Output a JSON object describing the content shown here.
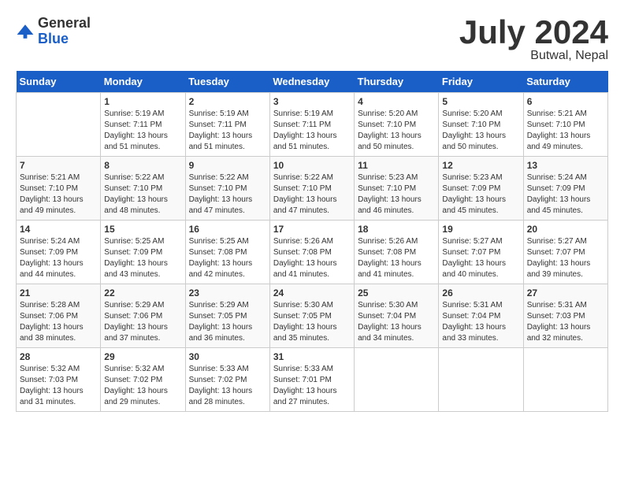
{
  "header": {
    "logo_general": "General",
    "logo_blue": "Blue",
    "month_title": "July 2024",
    "location": "Butwal, Nepal"
  },
  "weekdays": [
    "Sunday",
    "Monday",
    "Tuesday",
    "Wednesday",
    "Thursday",
    "Friday",
    "Saturday"
  ],
  "weeks": [
    [
      {
        "day": "",
        "info": ""
      },
      {
        "day": "1",
        "info": "Sunrise: 5:19 AM\nSunset: 7:11 PM\nDaylight: 13 hours\nand 51 minutes."
      },
      {
        "day": "2",
        "info": "Sunrise: 5:19 AM\nSunset: 7:11 PM\nDaylight: 13 hours\nand 51 minutes."
      },
      {
        "day": "3",
        "info": "Sunrise: 5:19 AM\nSunset: 7:11 PM\nDaylight: 13 hours\nand 51 minutes."
      },
      {
        "day": "4",
        "info": "Sunrise: 5:20 AM\nSunset: 7:10 PM\nDaylight: 13 hours\nand 50 minutes."
      },
      {
        "day": "5",
        "info": "Sunrise: 5:20 AM\nSunset: 7:10 PM\nDaylight: 13 hours\nand 50 minutes."
      },
      {
        "day": "6",
        "info": "Sunrise: 5:21 AM\nSunset: 7:10 PM\nDaylight: 13 hours\nand 49 minutes."
      }
    ],
    [
      {
        "day": "7",
        "info": "Sunrise: 5:21 AM\nSunset: 7:10 PM\nDaylight: 13 hours\nand 49 minutes."
      },
      {
        "day": "8",
        "info": "Sunrise: 5:22 AM\nSunset: 7:10 PM\nDaylight: 13 hours\nand 48 minutes."
      },
      {
        "day": "9",
        "info": "Sunrise: 5:22 AM\nSunset: 7:10 PM\nDaylight: 13 hours\nand 47 minutes."
      },
      {
        "day": "10",
        "info": "Sunrise: 5:22 AM\nSunset: 7:10 PM\nDaylight: 13 hours\nand 47 minutes."
      },
      {
        "day": "11",
        "info": "Sunrise: 5:23 AM\nSunset: 7:10 PM\nDaylight: 13 hours\nand 46 minutes."
      },
      {
        "day": "12",
        "info": "Sunrise: 5:23 AM\nSunset: 7:09 PM\nDaylight: 13 hours\nand 45 minutes."
      },
      {
        "day": "13",
        "info": "Sunrise: 5:24 AM\nSunset: 7:09 PM\nDaylight: 13 hours\nand 45 minutes."
      }
    ],
    [
      {
        "day": "14",
        "info": "Sunrise: 5:24 AM\nSunset: 7:09 PM\nDaylight: 13 hours\nand 44 minutes."
      },
      {
        "day": "15",
        "info": "Sunrise: 5:25 AM\nSunset: 7:09 PM\nDaylight: 13 hours\nand 43 minutes."
      },
      {
        "day": "16",
        "info": "Sunrise: 5:25 AM\nSunset: 7:08 PM\nDaylight: 13 hours\nand 42 minutes."
      },
      {
        "day": "17",
        "info": "Sunrise: 5:26 AM\nSunset: 7:08 PM\nDaylight: 13 hours\nand 41 minutes."
      },
      {
        "day": "18",
        "info": "Sunrise: 5:26 AM\nSunset: 7:08 PM\nDaylight: 13 hours\nand 41 minutes."
      },
      {
        "day": "19",
        "info": "Sunrise: 5:27 AM\nSunset: 7:07 PM\nDaylight: 13 hours\nand 40 minutes."
      },
      {
        "day": "20",
        "info": "Sunrise: 5:27 AM\nSunset: 7:07 PM\nDaylight: 13 hours\nand 39 minutes."
      }
    ],
    [
      {
        "day": "21",
        "info": "Sunrise: 5:28 AM\nSunset: 7:06 PM\nDaylight: 13 hours\nand 38 minutes."
      },
      {
        "day": "22",
        "info": "Sunrise: 5:29 AM\nSunset: 7:06 PM\nDaylight: 13 hours\nand 37 minutes."
      },
      {
        "day": "23",
        "info": "Sunrise: 5:29 AM\nSunset: 7:05 PM\nDaylight: 13 hours\nand 36 minutes."
      },
      {
        "day": "24",
        "info": "Sunrise: 5:30 AM\nSunset: 7:05 PM\nDaylight: 13 hours\nand 35 minutes."
      },
      {
        "day": "25",
        "info": "Sunrise: 5:30 AM\nSunset: 7:04 PM\nDaylight: 13 hours\nand 34 minutes."
      },
      {
        "day": "26",
        "info": "Sunrise: 5:31 AM\nSunset: 7:04 PM\nDaylight: 13 hours\nand 33 minutes."
      },
      {
        "day": "27",
        "info": "Sunrise: 5:31 AM\nSunset: 7:03 PM\nDaylight: 13 hours\nand 32 minutes."
      }
    ],
    [
      {
        "day": "28",
        "info": "Sunrise: 5:32 AM\nSunset: 7:03 PM\nDaylight: 13 hours\nand 31 minutes."
      },
      {
        "day": "29",
        "info": "Sunrise: 5:32 AM\nSunset: 7:02 PM\nDaylight: 13 hours\nand 29 minutes."
      },
      {
        "day": "30",
        "info": "Sunrise: 5:33 AM\nSunset: 7:02 PM\nDaylight: 13 hours\nand 28 minutes."
      },
      {
        "day": "31",
        "info": "Sunrise: 5:33 AM\nSunset: 7:01 PM\nDaylight: 13 hours\nand 27 minutes."
      },
      {
        "day": "",
        "info": ""
      },
      {
        "day": "",
        "info": ""
      },
      {
        "day": "",
        "info": ""
      }
    ]
  ]
}
